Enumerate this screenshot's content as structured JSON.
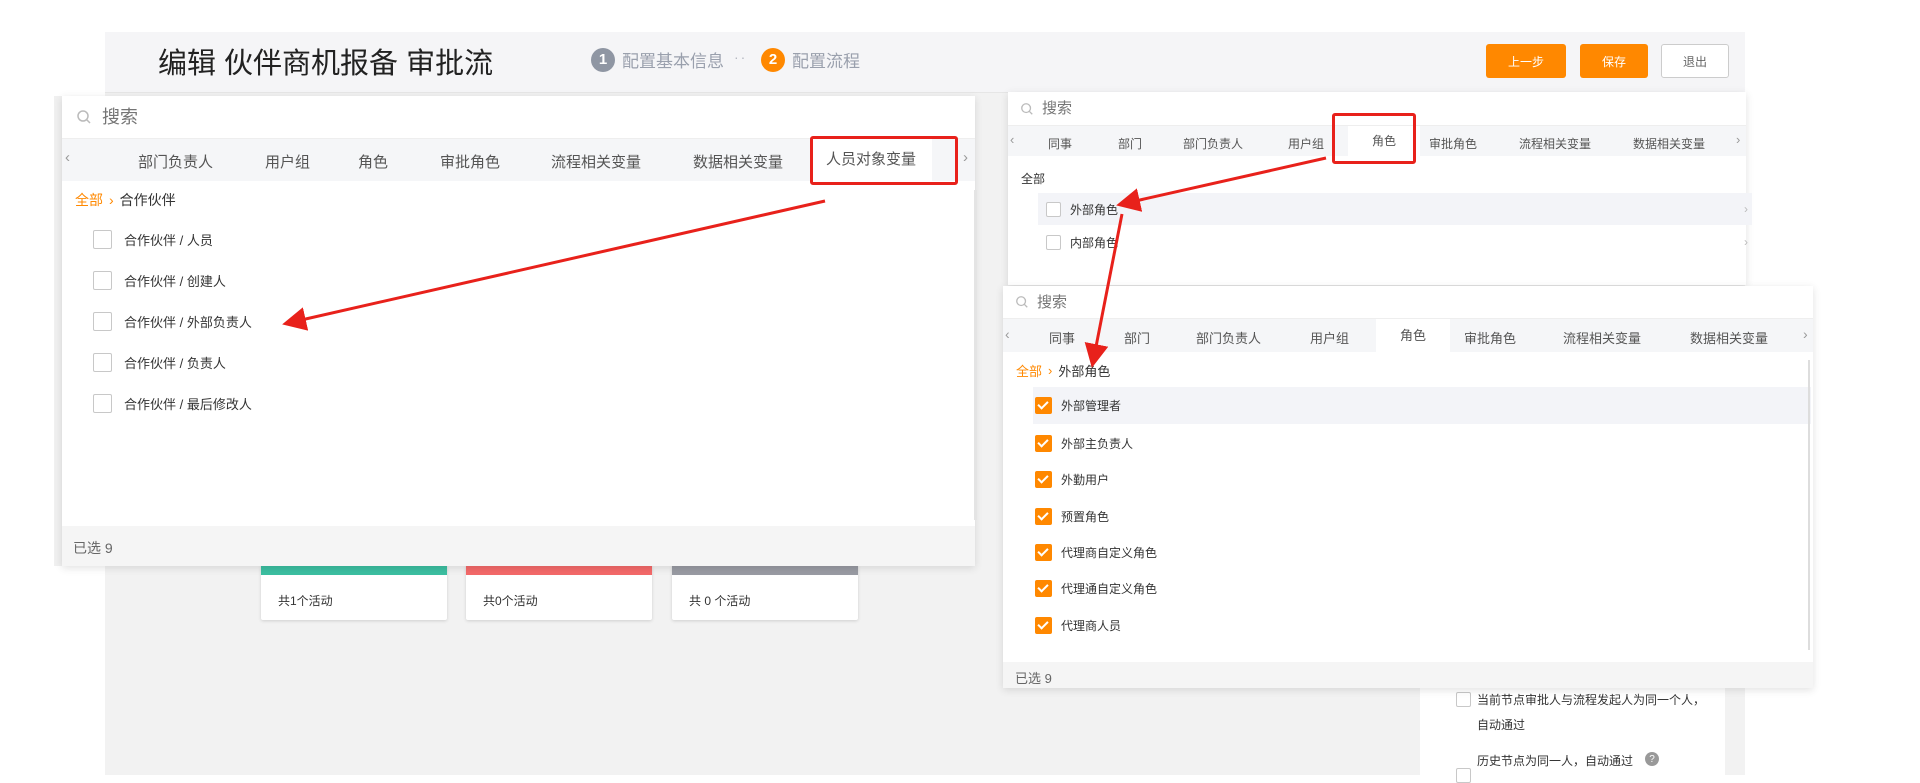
{
  "header": {
    "title": "编辑 伙伴商机报备 审批流",
    "steps": [
      {
        "num": "1",
        "label": "配置基本信息"
      },
      {
        "num": "2",
        "label": "配置流程"
      }
    ],
    "separator": "··",
    "buttons": {
      "prev": "上一步",
      "save": "保存",
      "exit": "退出"
    }
  },
  "cards": [
    {
      "text": "共1个活动"
    },
    {
      "text": "共0个活动"
    },
    {
      "text": "共 0 个活动"
    }
  ],
  "settings": {
    "opt1": "当前节点审批人与流程发起人为同一个人，",
    "opt1_cont": "自动通过",
    "opt2": "历史节点为同一人，自动通过",
    "help": "?"
  },
  "popup_left": {
    "search_placeholder": "搜索",
    "tabs": [
      "部门负责人",
      "用户组",
      "角色",
      "审批角色",
      "流程相关变量",
      "数据相关变量",
      "人员对象变量"
    ],
    "active_tab": "人员对象变量",
    "breadcrumb": {
      "all": "全部",
      "current": "合作伙伴"
    },
    "items": [
      "合作伙伴 / 人员",
      "合作伙伴 / 创建人",
      "合作伙伴 / 外部负责人",
      "合作伙伴 / 负责人",
      "合作伙伴 / 最后修改人"
    ],
    "footer": "已选 9"
  },
  "popup_right_top": {
    "search_placeholder": "搜索",
    "tabs": [
      "同事",
      "部门",
      "部门负责人",
      "用户组",
      "角色",
      "审批角色",
      "流程相关变量",
      "数据相关变量"
    ],
    "active_tab": "角色",
    "section": "全部",
    "items": [
      "外部角色",
      "内部角色"
    ]
  },
  "popup_right_bottom": {
    "search_placeholder": "搜索",
    "tabs": [
      "同事",
      "部门",
      "部门负责人",
      "用户组",
      "角色",
      "审批角色",
      "流程相关变量",
      "数据相关变量"
    ],
    "active_tab": "角色",
    "breadcrumb": {
      "all": "全部",
      "current": "外部角色"
    },
    "items": [
      "外部管理者",
      "外部主负责人",
      "外勤用户",
      "预置角色",
      "代理商自定义角色",
      "代理通自定义角色",
      "代理商人员"
    ],
    "footer": "已选 9"
  },
  "colors": {
    "accent": "#ff8800",
    "annotation": "#e8211b"
  },
  "icons": {
    "search": "search-icon",
    "left": "chevron-left-icon",
    "right": "chevron-right-icon"
  }
}
